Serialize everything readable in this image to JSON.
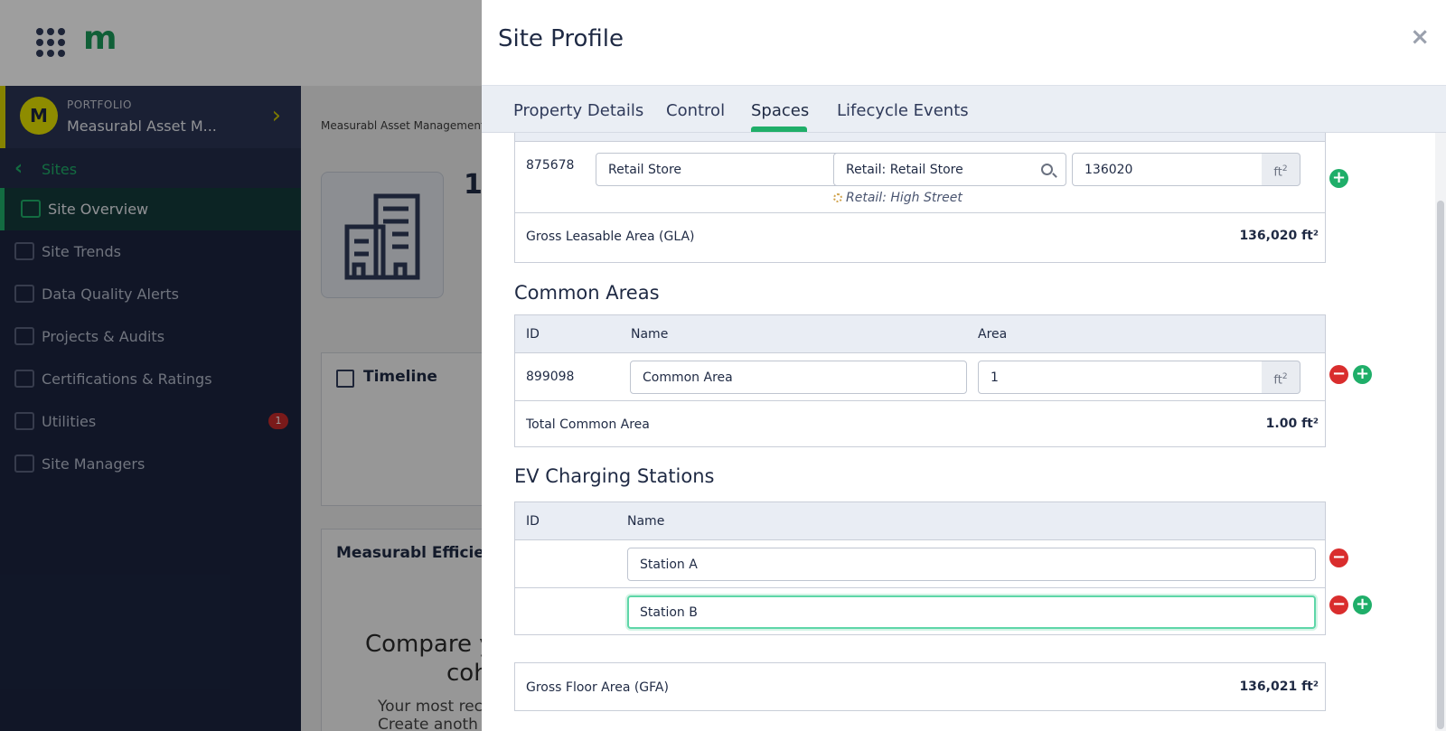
{
  "app": {
    "logo": "m",
    "portfolio": {
      "avatar": "M",
      "label": "PORTFOLIO",
      "name": "Measurabl Asset M..."
    },
    "sites_label": "Sites",
    "nav": [
      {
        "label": "Site Overview",
        "icon": "chart-icon",
        "active": true
      },
      {
        "label": "Site Trends",
        "icon": "trend-icon"
      },
      {
        "label": "Data Quality Alerts",
        "icon": "database-alert-icon"
      },
      {
        "label": "Projects & Audits",
        "icon": "tools-icon"
      },
      {
        "label": "Certifications & Ratings",
        "icon": "badge-icon"
      },
      {
        "label": "Utilities",
        "icon": "gauge-icon",
        "badge": "1"
      },
      {
        "label": "Site Managers",
        "icon": "users-icon"
      }
    ],
    "breadcrumb": "Measurabl Asset Management",
    "site_initial": "1",
    "timeline_title": "Timeline",
    "efficiency_title": "Measurabl Efficien",
    "efficiency_line1": "Compare y",
    "efficiency_line2": "coh",
    "efficiency_line3": "Your most rec",
    "efficiency_line4": "Create anoth"
  },
  "drawer": {
    "title": "Site Profile",
    "close": "×",
    "tabs": [
      {
        "label": "Property Details"
      },
      {
        "label": "Control"
      },
      {
        "label": "Spaces",
        "active": true
      },
      {
        "label": "Lifecycle Events"
      }
    ],
    "lettable": {
      "id": "875678",
      "name": "Retail Store",
      "type": "Retail: Retail Store",
      "subtype": "Retail: High Street",
      "area": "136020",
      "unit": "ft²",
      "total_label": "Gross Leasable Area (GLA)",
      "total_value": "136,020 ft²"
    },
    "common": {
      "title": "Common Areas",
      "headers": {
        "id": "ID",
        "name": "Name",
        "area": "Area"
      },
      "id": "899098",
      "name": "Common Area",
      "area": "1",
      "unit": "ft²",
      "total_label": "Total Common Area",
      "total_value": "1.00 ft²"
    },
    "ev": {
      "title": "EV Charging Stations",
      "headers": {
        "id": "ID",
        "name": "Name"
      },
      "stations": [
        "Station A",
        "Station B"
      ]
    },
    "gfa": {
      "label": "Gross Floor Area (GFA)",
      "value": "136,021 ft²"
    },
    "colors": {
      "accent": "#1fae69",
      "remove": "#d92d2d",
      "sidebar": "#1c2540"
    }
  }
}
